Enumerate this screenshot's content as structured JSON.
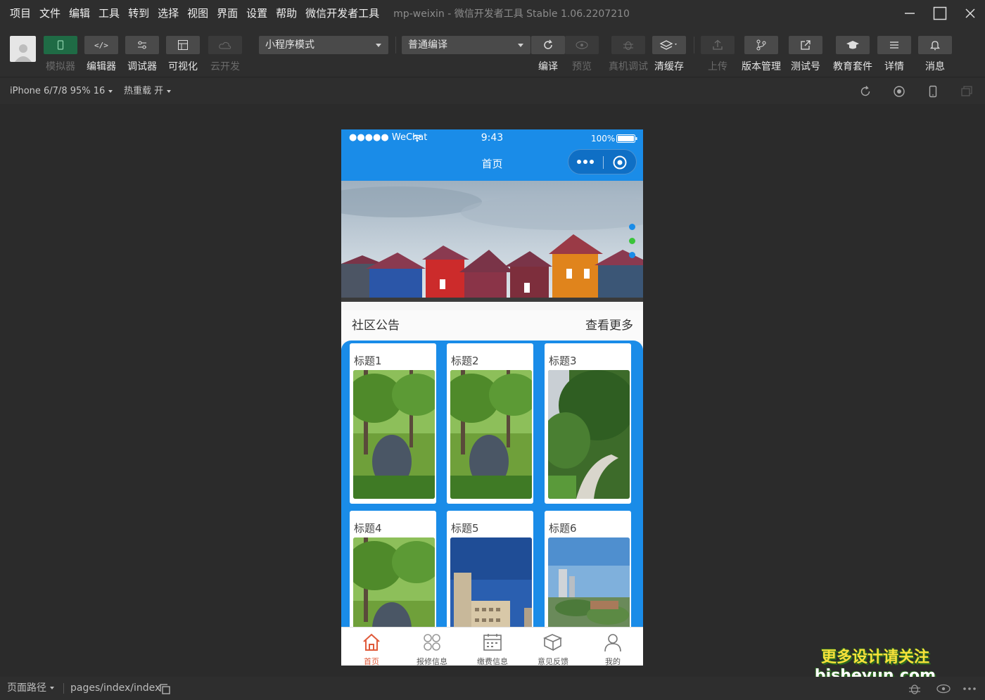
{
  "menubar": {
    "items": [
      "项目",
      "文件",
      "编辑",
      "工具",
      "转到",
      "选择",
      "视图",
      "界面",
      "设置",
      "帮助",
      "微信开发者工具"
    ],
    "app_title": "mp-weixin - 微信开发者工具 Stable 1.06.2207210"
  },
  "toolbar": {
    "simulator": "模拟器",
    "editor": "编辑器",
    "debugger": "调试器",
    "visual": "可视化",
    "cloud": "云开发",
    "mode_select": "小程序模式",
    "compile_select": "普通编译",
    "compile": "编译",
    "preview": "预览",
    "remote_debug": "真机调试",
    "clear_cache": "清缓存",
    "upload": "上传",
    "version": "版本管理",
    "test_account": "测试号",
    "edu_kit": "教育套件",
    "details": "详情",
    "messages": "消息"
  },
  "subbar": {
    "device": "iPhone 6/7/8 95% 16",
    "hot_reload": "热重载 开"
  },
  "phone": {
    "carrier": "●●●●● WeChat",
    "time": "9:43",
    "battery": "100%",
    "nav_title": "首页",
    "notice_title": "社区公告",
    "notice_more": "查看更多",
    "cards": [
      {
        "title": "标题1"
      },
      {
        "title": "标题2"
      },
      {
        "title": "标题3"
      },
      {
        "title": "标题4"
      },
      {
        "title": "标题5"
      },
      {
        "title": "标题6"
      }
    ],
    "tabs": [
      {
        "label": "首页",
        "icon": "home-icon"
      },
      {
        "label": "报修信息",
        "icon": "repair-icon"
      },
      {
        "label": "缴费信息",
        "icon": "payment-icon"
      },
      {
        "label": "意见反馈",
        "icon": "feedback-icon"
      },
      {
        "label": "我的",
        "icon": "user-icon"
      }
    ]
  },
  "footer": {
    "path_label": "页面路径",
    "path_value": "pages/index/index"
  },
  "watermark": {
    "line1": "更多设计请关注",
    "line2": "bisheyun.com"
  },
  "colors": {
    "accent": "#1a8ce8",
    "active_tab": "#e05a3a",
    "simulator_green": "#1f6b45"
  }
}
